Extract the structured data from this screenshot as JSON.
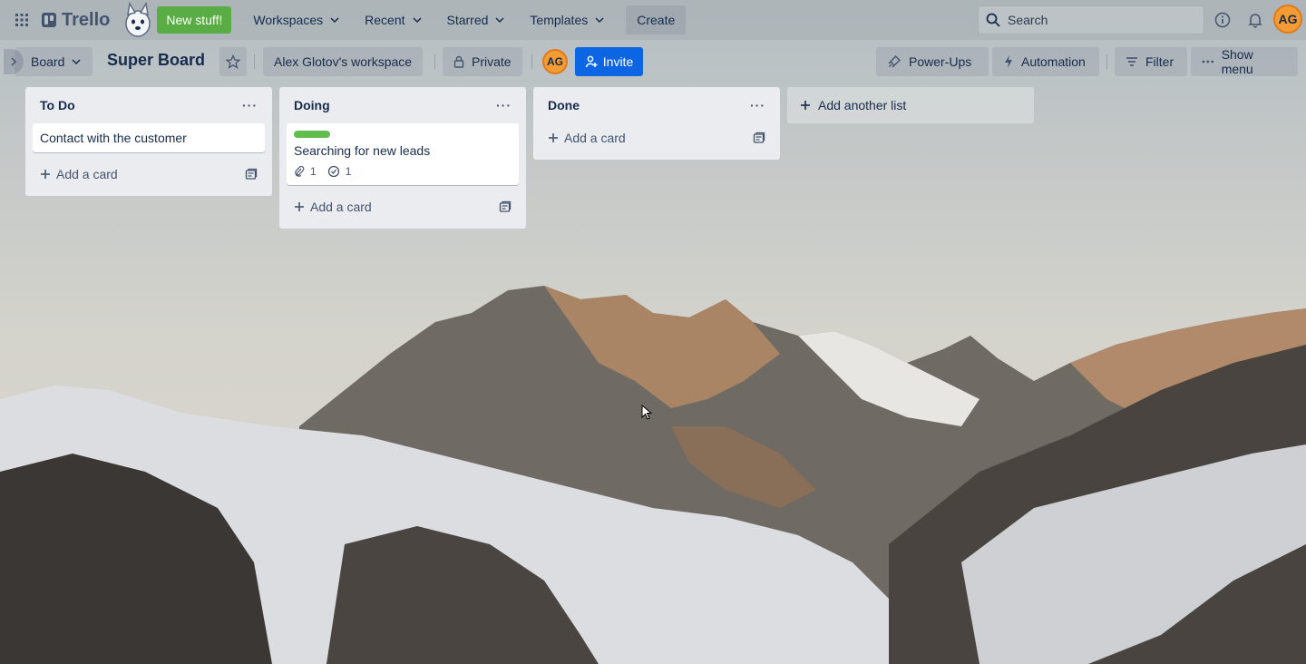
{
  "header": {
    "app_name": "Trello",
    "new_stuff": "New stuff!",
    "nav": [
      "Workspaces",
      "Recent",
      "Starred",
      "Templates"
    ],
    "create": "Create",
    "search_placeholder": "Search",
    "avatar_initials": "AG"
  },
  "board": {
    "view": "Board",
    "title": "Super Board",
    "workspace": "Alex Glotov's workspace",
    "visibility": "Private",
    "member_initials": "AG",
    "invite": "Invite",
    "power_ups": "Power-Ups",
    "automation": "Automation",
    "filter": "Filter",
    "show_menu": "Show menu"
  },
  "lists": [
    {
      "title": "To Do",
      "menu": "···",
      "cards": [
        {
          "title": "Contact with the customer"
        }
      ],
      "add_card": "Add a card"
    },
    {
      "title": "Doing",
      "menu": "···",
      "cards": [
        {
          "title": "Searching for new leads",
          "label_color": "#61bd4f",
          "attachments": "1",
          "checklist": "1"
        }
      ],
      "add_card": "Add a card"
    },
    {
      "title": "Done",
      "menu": "···",
      "cards": [],
      "add_card": "Add a card"
    }
  ],
  "add_list": "Add another list",
  "colors": {
    "accent": "#0c66e4",
    "new_stuff": "#5aac44",
    "avatar": "#f39c33",
    "list_bg": "#ebecf0"
  }
}
